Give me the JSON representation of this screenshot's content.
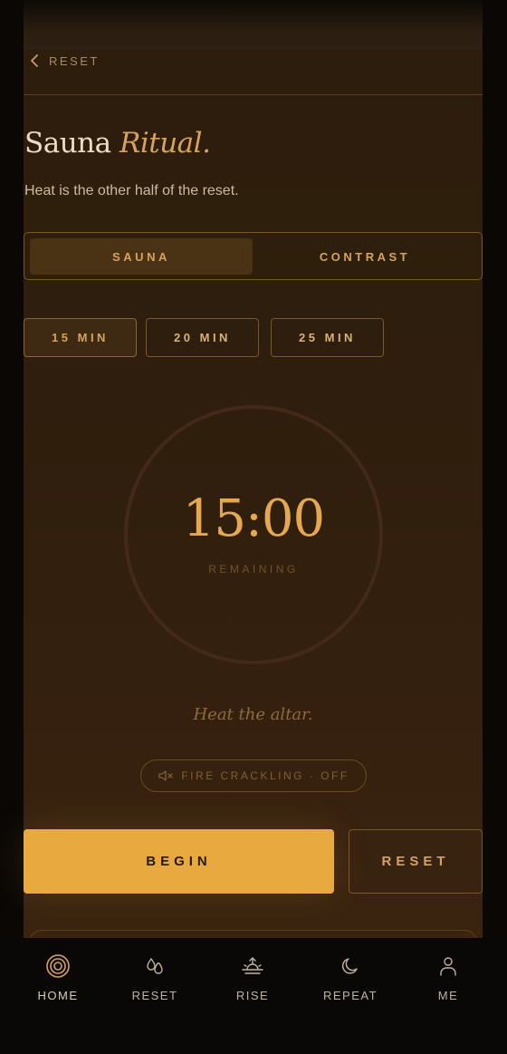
{
  "header": {
    "back_label": "RESET"
  },
  "page": {
    "title_plain": "Sauna",
    "title_accent": "Ritual.",
    "subtitle": "Heat is the other half of the reset."
  },
  "mode_toggle": {
    "options": [
      "SAUNA",
      "CONTRAST"
    ],
    "selected": "SAUNA"
  },
  "durations": {
    "options": [
      "15 MIN",
      "20 MIN",
      "25 MIN"
    ],
    "selected": "15 MIN"
  },
  "timer": {
    "value": "15:00",
    "label": "REMAINING"
  },
  "prompt": "Heat the altar.",
  "sound": {
    "label": "FIRE CRACKLING · OFF",
    "icon": "speaker-muted-icon"
  },
  "actions": {
    "begin": "BEGIN",
    "reset": "RESET"
  },
  "nav": {
    "items": [
      {
        "label": "HOME",
        "icon": "concentric-circles-icon",
        "active": true
      },
      {
        "label": "RESET",
        "icon": "water-drops-icon",
        "active": false
      },
      {
        "label": "RISE",
        "icon": "sunrise-icon",
        "active": false
      },
      {
        "label": "REPEAT",
        "icon": "moon-icon",
        "active": false
      },
      {
        "label": "ME",
        "icon": "person-icon",
        "active": false
      }
    ]
  },
  "colors": {
    "accent": "#e8a93f",
    "accent_text": "#d6a35c",
    "panel_bg": "#2f1e0d",
    "page_bg": "#0b0806"
  }
}
